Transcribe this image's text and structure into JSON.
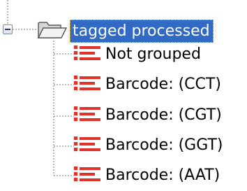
{
  "tree": {
    "root": {
      "label": "tagged processed",
      "icon": "folder-open-icon",
      "expanded": true,
      "selected": true
    },
    "children": [
      {
        "label": "Not grouped",
        "icon": "sequence-list-icon"
      },
      {
        "label": "Barcode: (CCT)",
        "icon": "sequence-list-icon"
      },
      {
        "label": "Barcode: (CGT)",
        "icon": "sequence-list-icon"
      },
      {
        "label": "Barcode: (GGT)",
        "icon": "sequence-list-icon"
      },
      {
        "label": "Barcode: (AAT)",
        "icon": "sequence-list-icon"
      }
    ]
  },
  "colors": {
    "selection": "#316ac5",
    "selection_text": "#ffffff",
    "icon_red": "#e0322a",
    "tree_line": "#a0a0a0"
  }
}
